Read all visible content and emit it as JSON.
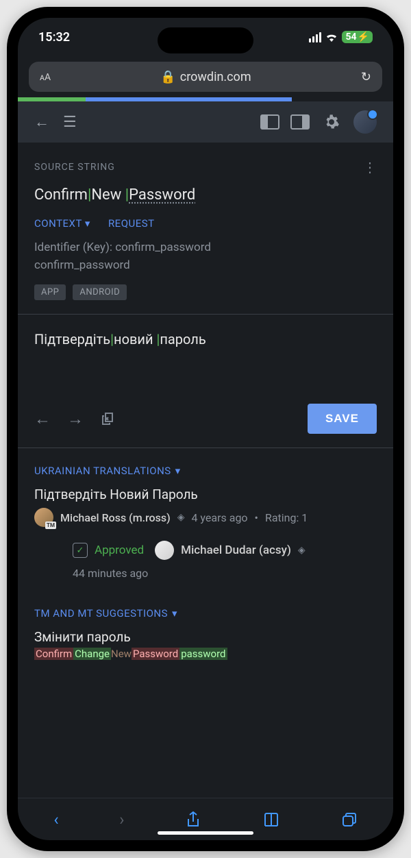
{
  "status": {
    "time": "15:32",
    "battery": "54"
  },
  "browser": {
    "url": "crowdin.com"
  },
  "source": {
    "section_label": "SOURCE STRING",
    "word1": "Confirm",
    "word2": "New",
    "word3": "Password",
    "context_label": "CONTEXT",
    "request_label": "REQUEST",
    "identifier_label": "Identifier (Key): confirm_password",
    "identifier_value": "confirm_password",
    "tags": [
      "APP",
      "ANDROID"
    ]
  },
  "translation": {
    "word1": "Підтвердіть",
    "word2": "новий",
    "word3": "пароль",
    "save_label": "SAVE"
  },
  "suggestions": {
    "section_label": "UKRAINIAN TRANSLATIONS",
    "item1": {
      "text": "Підтвердіть Новий Пароль",
      "author": "Michael Ross (m.ross)",
      "age": "4 years ago",
      "rating": "Rating: 1"
    },
    "approved": {
      "label": "Approved",
      "by": "Michael Dudar (acsy)",
      "time": "44 minutes ago"
    },
    "tm_label": "TM AND MT SUGGESTIONS",
    "tm_item": {
      "text": "Змінити пароль",
      "diff_del1": "Confirm",
      "diff_add1": "Change",
      "diff_stay1": " New ",
      "diff_del2": "Password",
      "diff_add2": "password"
    }
  }
}
